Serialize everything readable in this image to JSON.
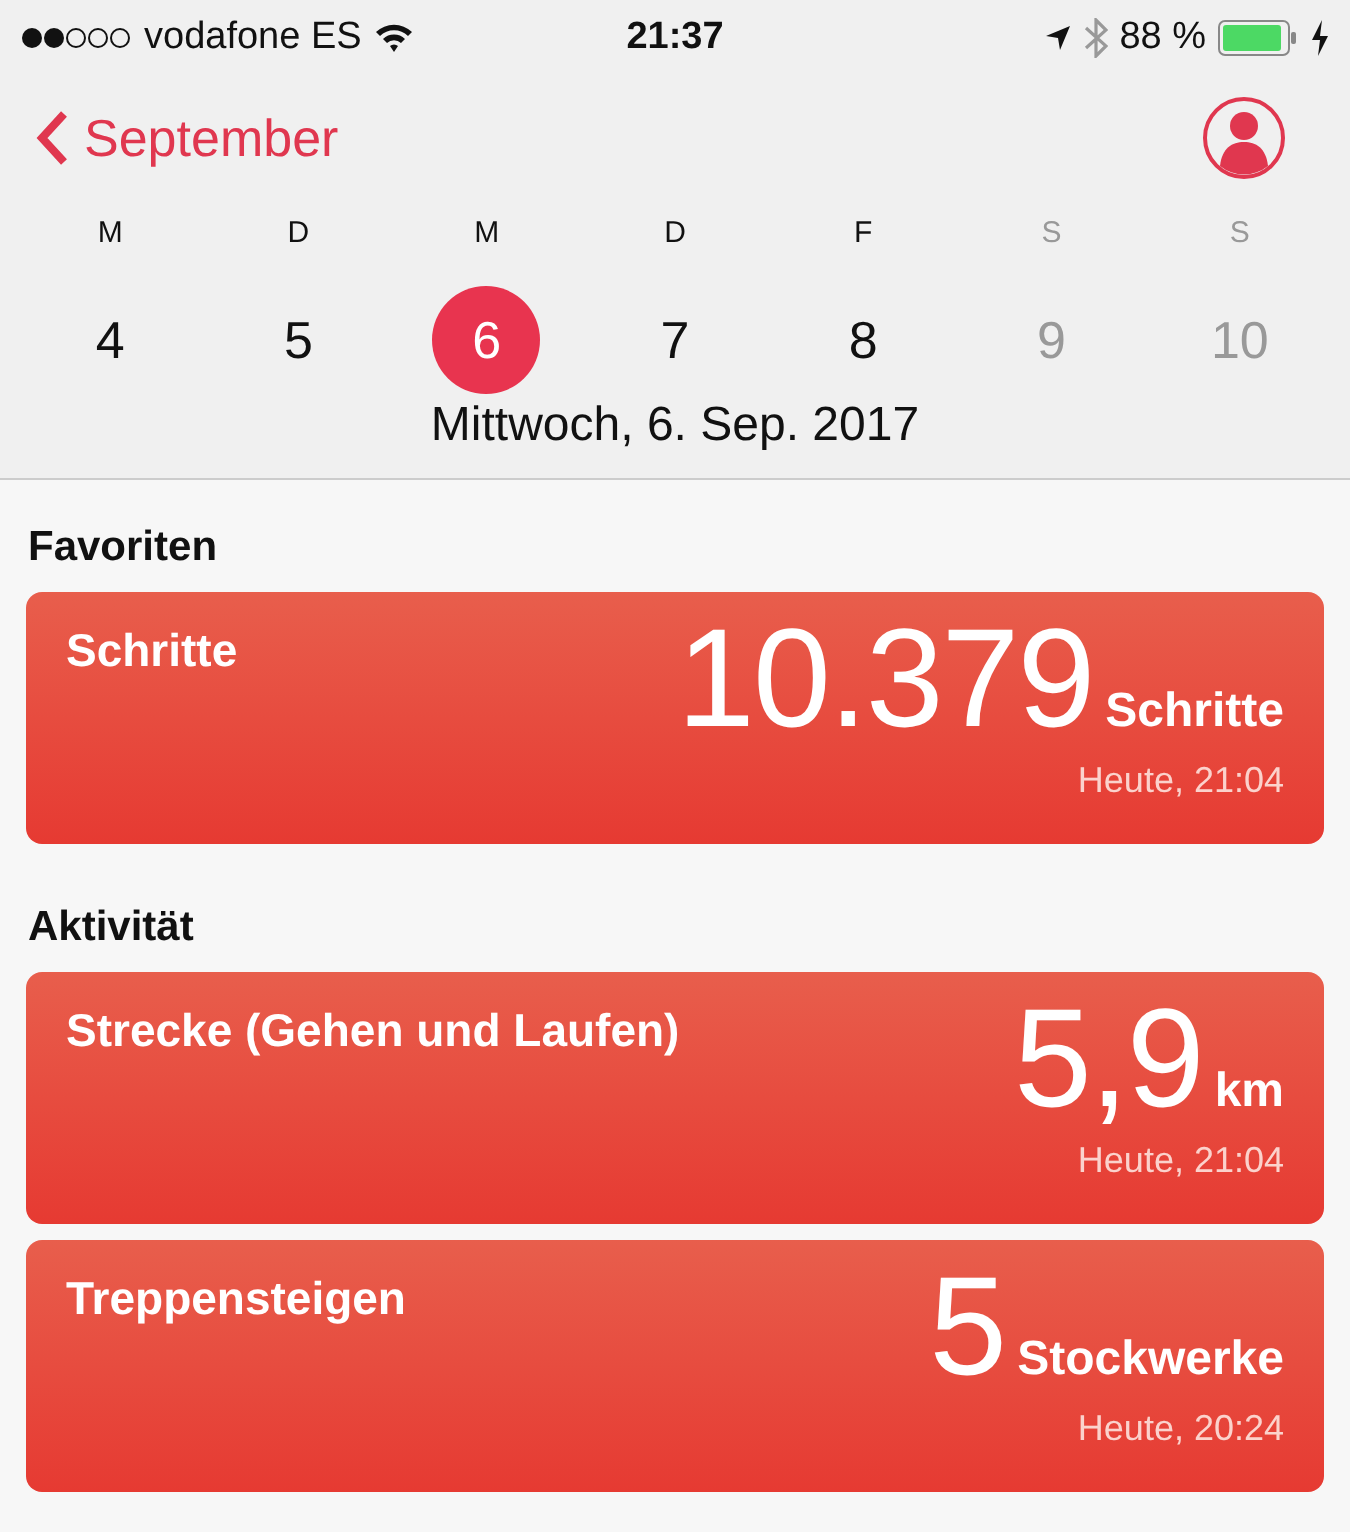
{
  "status_bar": {
    "carrier": "vodafone ES",
    "time": "21:37",
    "battery": "88 %"
  },
  "nav": {
    "back": "September"
  },
  "week": {
    "days": [
      {
        "weekday": "M",
        "day": "4",
        "selected": false,
        "dimmed": false
      },
      {
        "weekday": "D",
        "day": "5",
        "selected": false,
        "dimmed": false
      },
      {
        "weekday": "M",
        "day": "6",
        "selected": true,
        "dimmed": false
      },
      {
        "weekday": "D",
        "day": "7",
        "selected": false,
        "dimmed": false
      },
      {
        "weekday": "F",
        "day": "8",
        "selected": false,
        "dimmed": false
      },
      {
        "weekday": "S",
        "day": "9",
        "selected": false,
        "dimmed": true
      },
      {
        "weekday": "S",
        "day": "10",
        "selected": false,
        "dimmed": true
      }
    ],
    "date": "Mittwoch, 6. Sep. 2017"
  },
  "sections": [
    {
      "title": "Favoriten",
      "cards": [
        {
          "title": "Schritte",
          "value": "10.379",
          "unit": "Schritte",
          "time": "Heute, 21:04"
        }
      ]
    },
    {
      "title": "Aktivität",
      "cards": [
        {
          "title": "Strecke (Gehen und Laufen)",
          "value": "5,9",
          "unit": "km",
          "time": "Heute, 21:04"
        },
        {
          "title": "Treppensteigen",
          "value": "5",
          "unit": "Stockwerke",
          "time": "Heute, 20:24"
        }
      ]
    }
  ]
}
